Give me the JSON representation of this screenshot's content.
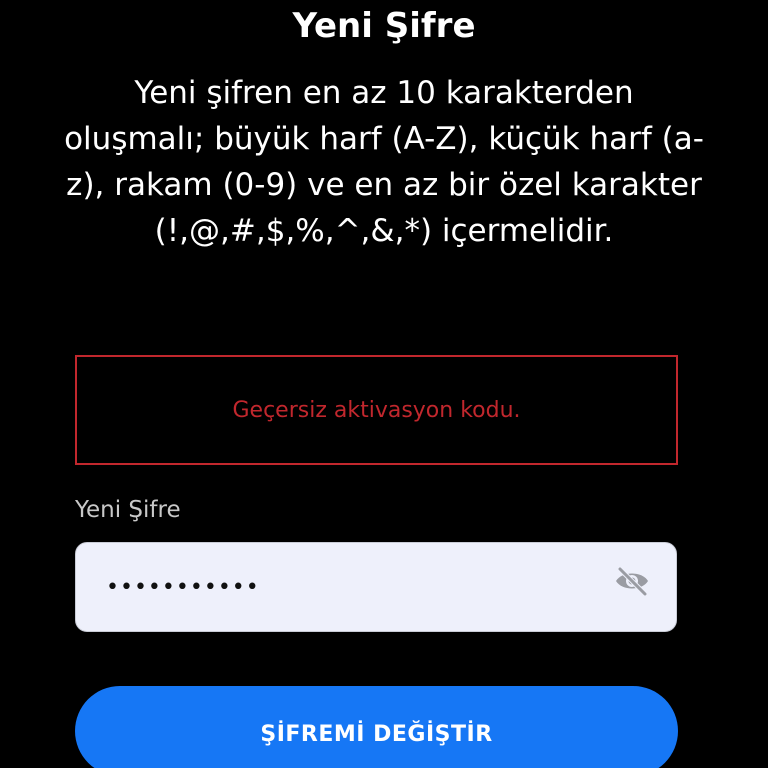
{
  "page": {
    "title": "Yeni Şifre",
    "instructions": "Yeni şifren en az 10 karakterden oluşmalı; büyük harf (A-Z), küçük harf (a-z), rakam (0-9) ve en az bir özel karakter (!,@,#,$,%,^,&,*) içermelidir."
  },
  "error": {
    "message": "Geçersiz aktivasyon kodu."
  },
  "password_field": {
    "label": "Yeni Şifre",
    "value": "•••••••••••",
    "toggle_icon": "eye-off-icon"
  },
  "submit": {
    "label": "ŞİFREMİ DEĞİŞTİR"
  },
  "colors": {
    "background": "#000000",
    "error": "#c1272d",
    "primary": "#1677f5",
    "field_bg": "#eef0fb"
  }
}
